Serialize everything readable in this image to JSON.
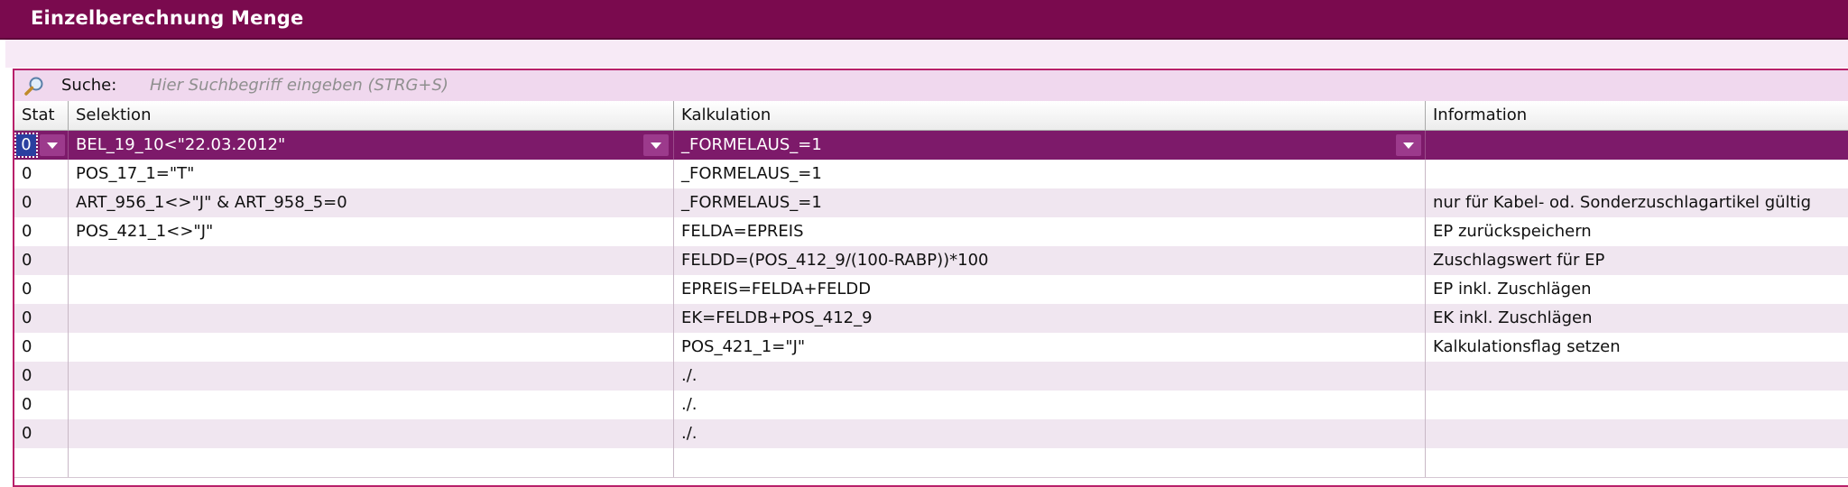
{
  "window": {
    "title": "Einzelberechnung Menge"
  },
  "search": {
    "label": "Suche:",
    "placeholder": "Hier Suchbegriff eingeben (STRG+S)"
  },
  "table": {
    "columns": [
      "Stat",
      "Selektion",
      "Kalkulation",
      "Information"
    ],
    "rows": [
      {
        "stat": "0",
        "selektion": "BEL_19_10<\"22.03.2012\"",
        "kalkulation": "_FORMELAUS_=1",
        "information": ""
      },
      {
        "stat": "0",
        "selektion": "POS_17_1=\"T\"",
        "kalkulation": "_FORMELAUS_=1",
        "information": ""
      },
      {
        "stat": "0",
        "selektion": "ART_956_1<>\"J\" & ART_958_5=0",
        "kalkulation": "_FORMELAUS_=1",
        "information": "nur für Kabel- od. Sonderzuschlagartikel gültig"
      },
      {
        "stat": "0",
        "selektion": "POS_421_1<>\"J\"",
        "kalkulation": "FELDA=EPREIS",
        "information": "EP zurückspeichern"
      },
      {
        "stat": "0",
        "selektion": "",
        "kalkulation": "FELDD=(POS_412_9/(100-RABP))*100",
        "information": "Zuschlagswert für EP"
      },
      {
        "stat": "0",
        "selektion": "",
        "kalkulation": "EPREIS=FELDA+FELDD",
        "information": "EP inkl. Zuschlägen"
      },
      {
        "stat": "0",
        "selektion": "",
        "kalkulation": "EK=FELDB+POS_412_9",
        "information": "EK  inkl. Zuschlägen"
      },
      {
        "stat": "0",
        "selektion": "",
        "kalkulation": "POS_421_1=\"J\"",
        "information": "Kalkulationsflag setzen"
      },
      {
        "stat": "0",
        "selektion": "",
        "kalkulation": "./.",
        "information": ""
      },
      {
        "stat": "0",
        "selektion": "",
        "kalkulation": "./.",
        "information": ""
      },
      {
        "stat": "0",
        "selektion": "",
        "kalkulation": "./.",
        "information": ""
      },
      {
        "stat": "",
        "selektion": "",
        "kalkulation": "",
        "information": ""
      }
    ],
    "selected_row": 0
  },
  "colors": {
    "titlebar": "#7a0a4e",
    "selected_row": "#7d1a6a",
    "search_band": "#f0d8ee"
  },
  "icons": {
    "search": "magnifier-icon",
    "dropdown": "chevron-down-icon"
  }
}
